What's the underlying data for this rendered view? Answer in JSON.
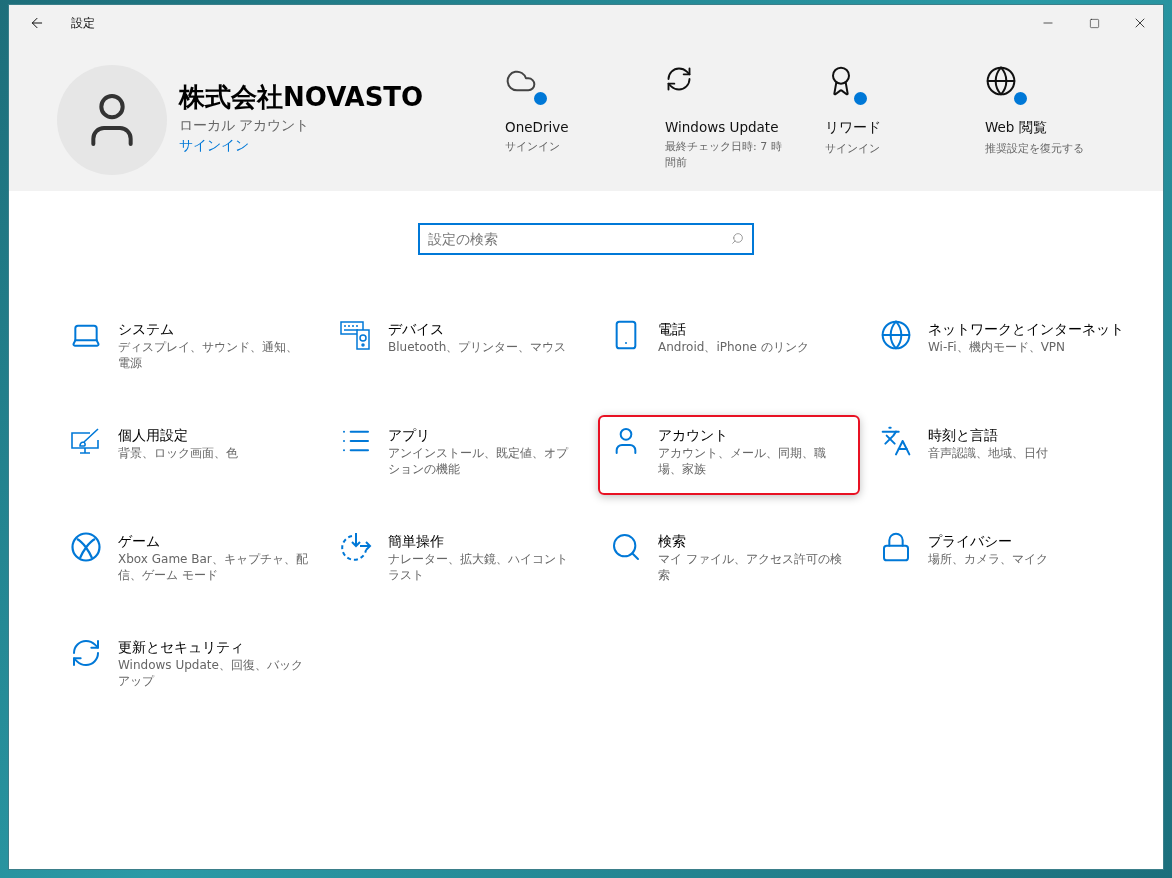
{
  "window": {
    "title": "設定"
  },
  "account": {
    "name": "株式会社NOVASTO",
    "type": "ローカル アカウント",
    "link": "サインイン"
  },
  "shortcuts": [
    {
      "title": "OneDrive",
      "subtitle": "サインイン",
      "badge": true
    },
    {
      "title": "Windows Update",
      "subtitle": "最終チェック日時: 7 時間前",
      "badge": false
    },
    {
      "title": "リワード",
      "subtitle": "サインイン",
      "badge": true
    },
    {
      "title": "Web 閲覧",
      "subtitle": "推奨設定を復元する",
      "badge": true
    }
  ],
  "search": {
    "placeholder": "設定の検索"
  },
  "categories": [
    {
      "title": "システム",
      "description": "ディスプレイ、サウンド、通知、電源",
      "selected": false
    },
    {
      "title": "デバイス",
      "description": "Bluetooth、プリンター、マウス",
      "selected": false
    },
    {
      "title": "電話",
      "description": "Android、iPhone のリンク",
      "selected": false
    },
    {
      "title": "ネットワークとインターネット",
      "description": "Wi-Fi、機内モード、VPN",
      "selected": false
    },
    {
      "title": "個人用設定",
      "description": "背景、ロック画面、色",
      "selected": false
    },
    {
      "title": "アプリ",
      "description": "アンインストール、既定値、オプションの機能",
      "selected": false
    },
    {
      "title": "アカウント",
      "description": "アカウント、メール、同期、職場、家族",
      "selected": true
    },
    {
      "title": "時刻と言語",
      "description": "音声認識、地域、日付",
      "selected": false
    },
    {
      "title": "ゲーム",
      "description": "Xbox Game Bar、キャプチャ、配信、ゲーム モード",
      "selected": false
    },
    {
      "title": "簡単操作",
      "description": "ナレーター、拡大鏡、ハイコントラスト",
      "selected": false
    },
    {
      "title": "検索",
      "description": "マイ ファイル、アクセス許可の検索",
      "selected": false
    },
    {
      "title": "プライバシー",
      "description": "場所、カメラ、マイク",
      "selected": false
    },
    {
      "title": "更新とセキュリティ",
      "description": "Windows Update、回復、バックアップ",
      "selected": false
    }
  ]
}
